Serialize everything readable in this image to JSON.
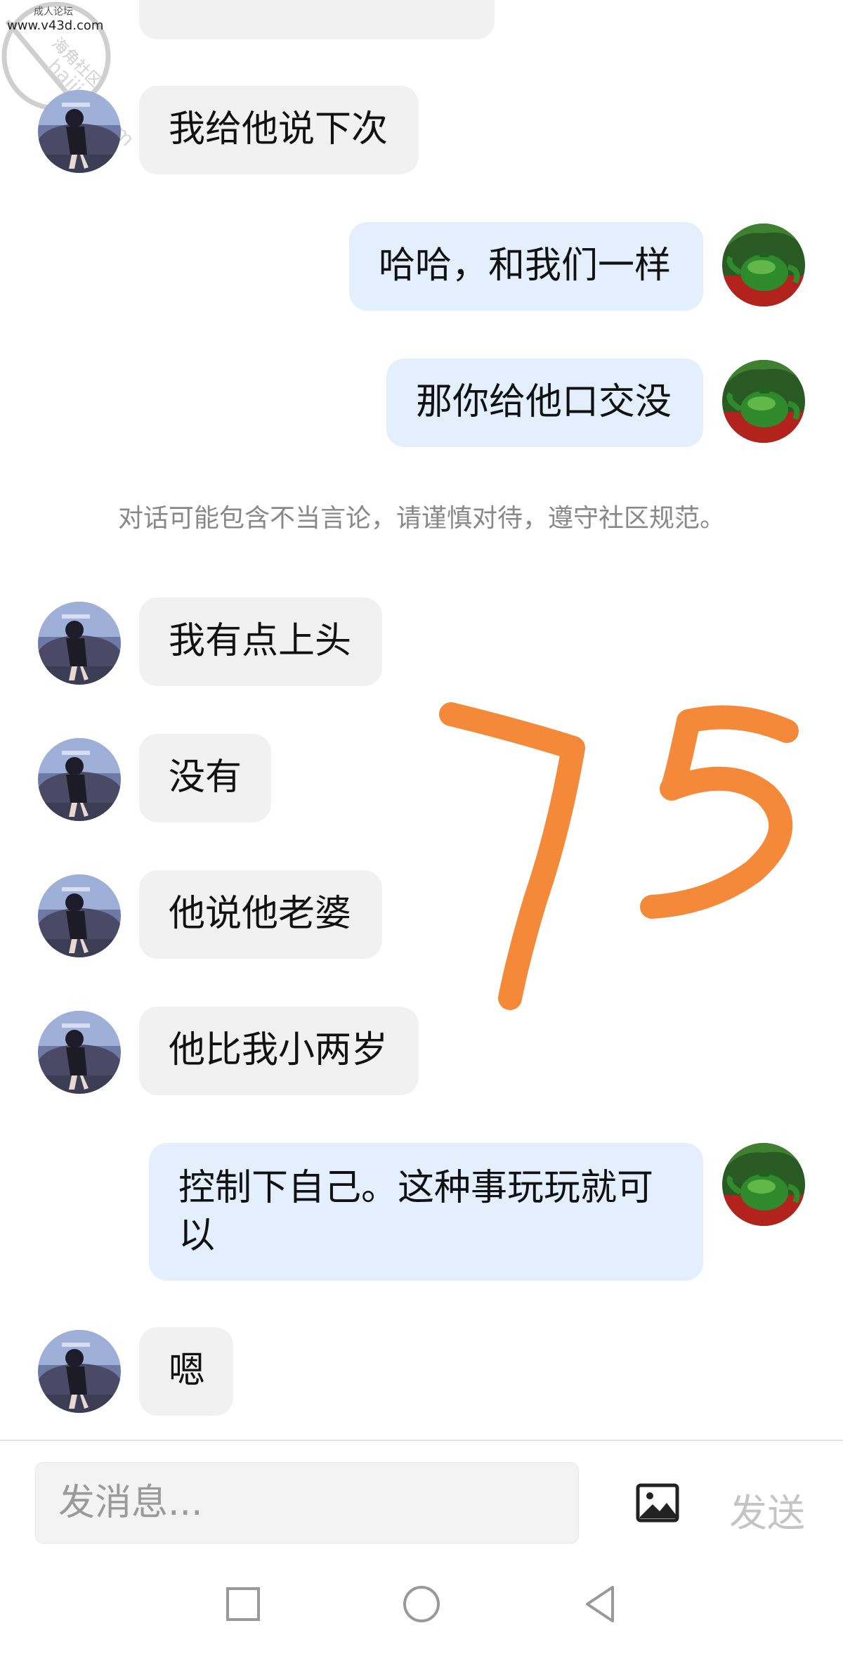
{
  "watermark": {
    "line1": "成人论坛",
    "line2": "www.v43d.com",
    "diagonal": "海角社区 haijiao.com"
  },
  "messages": [
    {
      "side": "in",
      "text": "我给他说下次"
    },
    {
      "side": "out",
      "text": "哈哈，和我们一样"
    },
    {
      "side": "out",
      "text": "那你给他口交没"
    },
    {
      "side": "in",
      "text": "我有点上头"
    },
    {
      "side": "in",
      "text": "没有"
    },
    {
      "side": "in",
      "text": "他说他老婆"
    },
    {
      "side": "in",
      "text": "他比我小两岁"
    },
    {
      "side": "out",
      "text": "控制下自己。这种事玩玩就可以"
    },
    {
      "side": "in",
      "text": "嗯"
    }
  ],
  "notice": "对话可能包含不当言论，请谨慎对待，遵守社区规范。",
  "annotation": "75",
  "composer": {
    "placeholder": "发消息...",
    "send_label": "发送",
    "image_icon": "image-icon"
  },
  "navbar": {
    "icons": [
      "recents-square-icon",
      "home-circle-icon",
      "back-triangle-icon"
    ]
  },
  "colors": {
    "incoming_bubble": "#f1f1f1",
    "outgoing_bubble": "#e3effd",
    "annotation": "#f5893a",
    "notice_text": "#888888",
    "send_disabled": "#c4c4c4"
  }
}
